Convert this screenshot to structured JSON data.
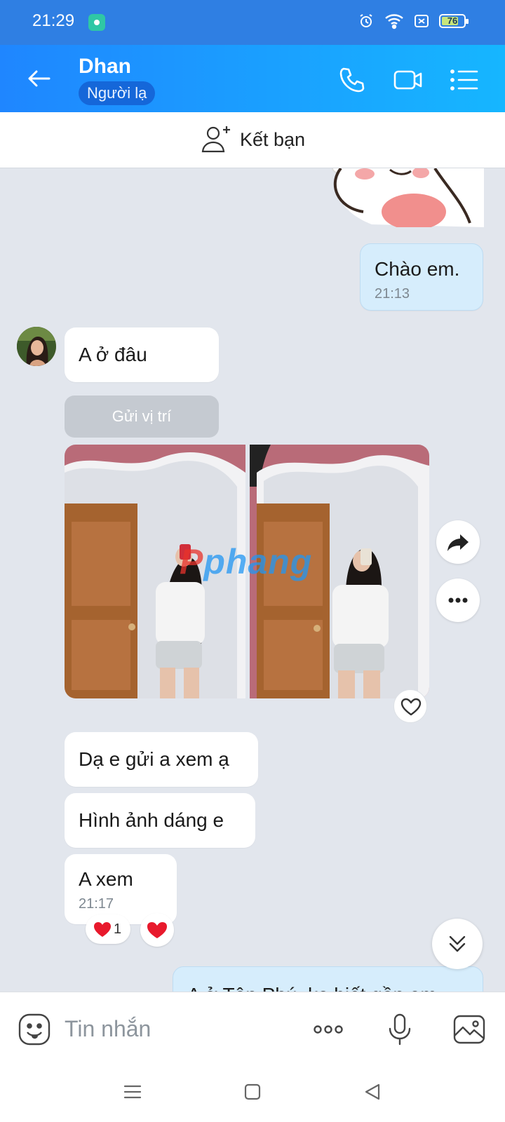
{
  "status_bar": {
    "time": "21:29",
    "battery": "76"
  },
  "header": {
    "name": "Dhan",
    "badge": "Người lạ"
  },
  "add_friend": {
    "label": "Kết bạn"
  },
  "messages": {
    "out_greeting": {
      "text": "Chào em.",
      "time": "21:13"
    },
    "in_where": {
      "text": "A ở đâu"
    },
    "location_button": "Gửi vị trí",
    "in_1": {
      "text": "Dạ e gửi a xem ạ"
    },
    "in_2": {
      "text": "Hình ảnh dáng e"
    },
    "in_3": {
      "text": "A xem",
      "time": "21:17"
    },
    "reaction_count": "1",
    "out_partial": {
      "text": "A ở Tân Phú, ko biết gần em"
    }
  },
  "watermark": {
    "first": "P",
    "rest": "phang"
  },
  "composer": {
    "placeholder": "Tin nhắn"
  },
  "icons": {
    "status": [
      "app-icon",
      "alarm-icon",
      "wifi-icon",
      "sim-icon",
      "battery-icon"
    ],
    "header": [
      "back-arrow-icon",
      "phone-icon",
      "video-camera-icon",
      "list-menu-icon"
    ],
    "composer": [
      "emoji-icon",
      "more-dots-icon",
      "microphone-icon",
      "image-gallery-icon"
    ],
    "nav": [
      "recent-apps-icon",
      "home-icon",
      "back-triangle-icon"
    ]
  },
  "colors": {
    "header_start": "#1f86ff",
    "header_end": "#16b6ff",
    "outgoing_bubble": "#d6edfc",
    "chat_background": "#e2e6ed"
  }
}
